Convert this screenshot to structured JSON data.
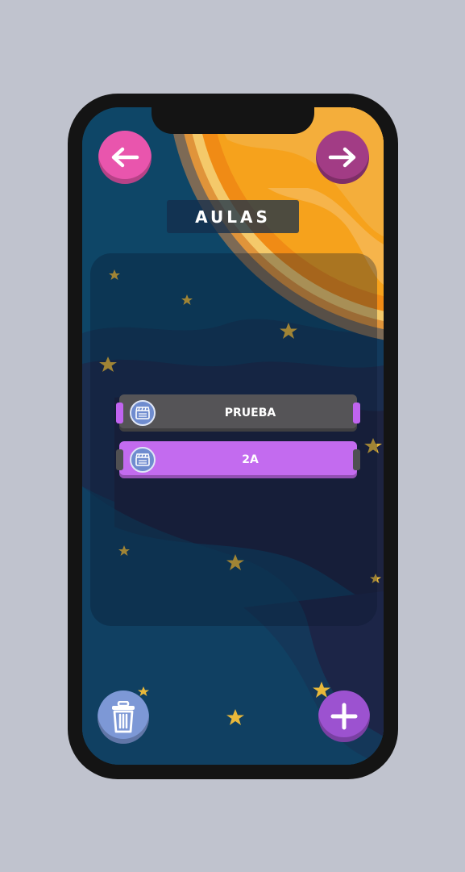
{
  "header": {
    "title": "AULAS"
  },
  "nav": {
    "back_icon": "arrow-left-icon",
    "forward_icon": "arrow-right-icon"
  },
  "classes": [
    {
      "name": "PRUEBA",
      "icon": "clapperboard-icon",
      "state": "default"
    },
    {
      "name": "2A",
      "icon": "clapperboard-icon",
      "state": "selected"
    }
  ],
  "actions": {
    "delete_icon": "trash-icon",
    "add_icon": "plus-icon"
  },
  "colors": {
    "back_button": "#e955ad",
    "forward_button": "#a23c85",
    "row_default": "#555457",
    "row_selected": "#c36bef",
    "delete_button": "#7d98d6",
    "add_button": "#9c52d0",
    "background": "#0e4667",
    "planet": "#f6a21c",
    "star": "#e8b83a"
  }
}
